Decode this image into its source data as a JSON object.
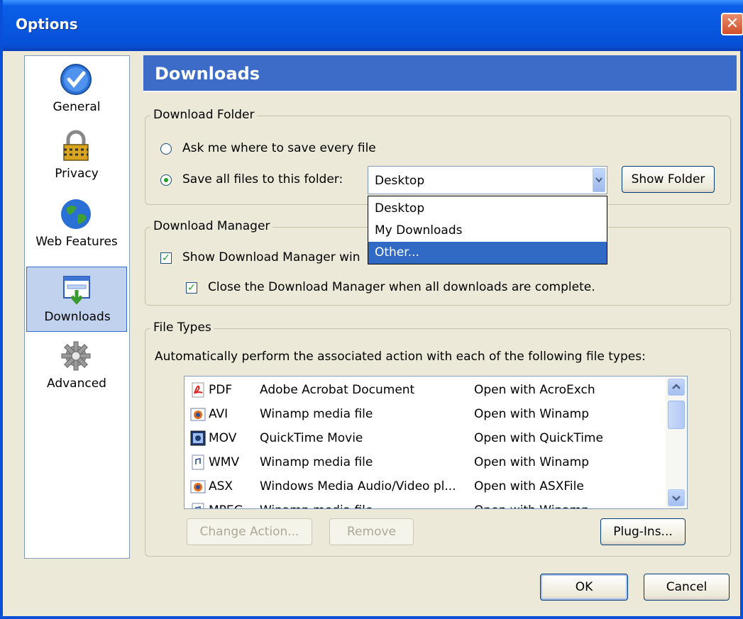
{
  "window": {
    "title": "Options",
    "close_label": "✕"
  },
  "sidebar": {
    "items": [
      {
        "label": "General",
        "icon": "check-icon"
      },
      {
        "label": "Privacy",
        "icon": "lock-icon"
      },
      {
        "label": "Web Features",
        "icon": "globe-icon"
      },
      {
        "label": "Downloads",
        "icon": "download-icon",
        "selected": true
      },
      {
        "label": "Advanced",
        "icon": "gear-icon"
      }
    ]
  },
  "panel": {
    "title": "Downloads"
  },
  "download_folder": {
    "group_title": "Download Folder",
    "ask_label": "Ask me where to save every file",
    "save_label": "Save all files to this folder:",
    "selected_option": "save",
    "folder_value": "Desktop",
    "show_folder_label": "Show Folder",
    "dropdown_options": [
      "Desktop",
      "My Downloads",
      "Other..."
    ],
    "dropdown_highlighted": "Other..."
  },
  "download_manager": {
    "group_title": "Download Manager",
    "show_label": "Show Download Manager win",
    "show_checked": true,
    "close_label": "Close the Download Manager when all downloads are complete.",
    "close_checked": true
  },
  "file_types": {
    "group_title": "File Types",
    "description": "Automatically perform the associated action with each of the following file types:",
    "rows": [
      {
        "ext": "PDF",
        "desc": "Adobe Acrobat Document",
        "action": "Open with AcroExch",
        "icon": "pdf-icon"
      },
      {
        "ext": "AVI",
        "desc": "Winamp media file",
        "action": "Open with Winamp",
        "icon": "winamp-icon"
      },
      {
        "ext": "MOV",
        "desc": "QuickTime Movie",
        "action": "Open with QuickTime",
        "icon": "quicktime-icon"
      },
      {
        "ext": "WMV",
        "desc": "Winamp media file",
        "action": "Open with Winamp",
        "icon": "media-file-icon"
      },
      {
        "ext": "ASX",
        "desc": "Windows Media Audio/Video pl...",
        "action": "Open with ASXFile",
        "icon": "winamp-icon"
      },
      {
        "ext": "MPEG",
        "desc": "Winamp media file",
        "action": "Open with Winamp",
        "icon": "media-file-icon"
      }
    ],
    "change_action_label": "Change Action...",
    "remove_label": "Remove",
    "plugins_label": "Plug-Ins..."
  },
  "footer": {
    "ok_label": "OK",
    "cancel_label": "Cancel"
  }
}
